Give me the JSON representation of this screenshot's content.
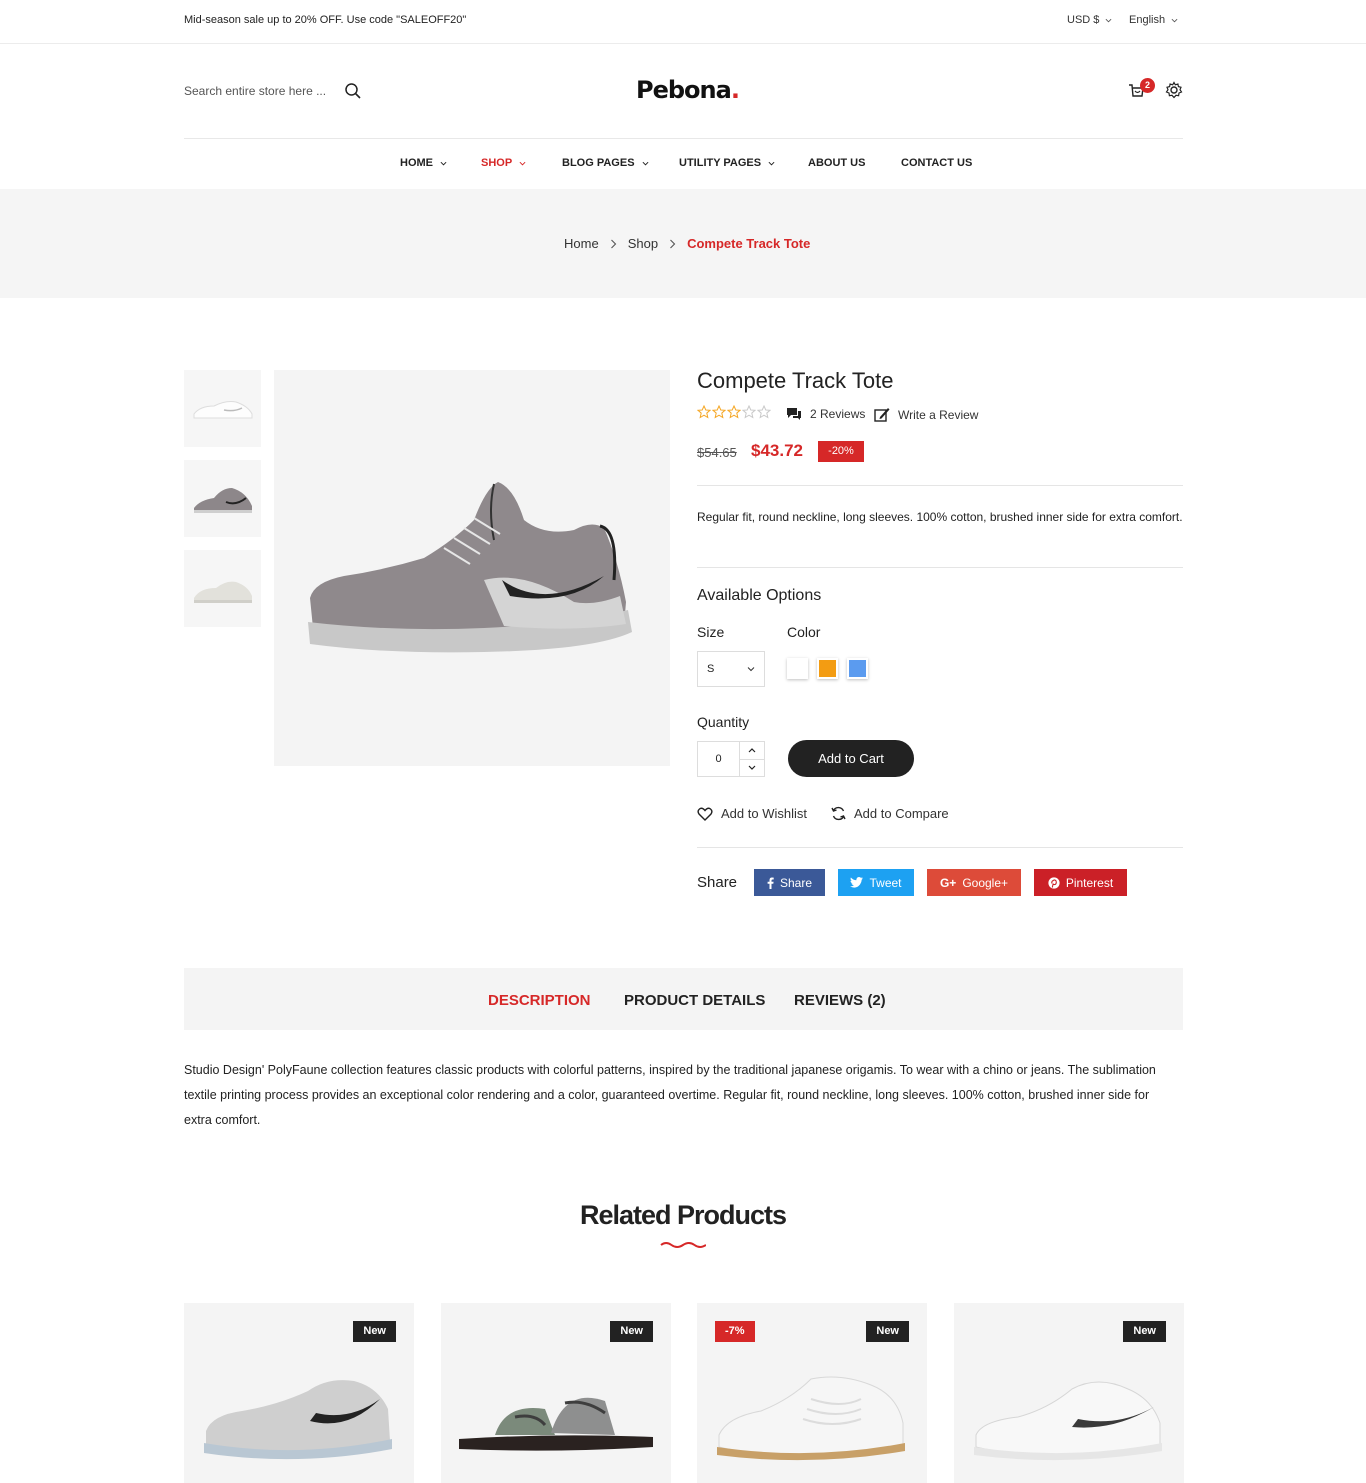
{
  "topbar": {
    "promo": "Mid-season sale up to 20% OFF. Use code \"SALEOFF20\"",
    "currency": "USD $",
    "language": "English"
  },
  "header": {
    "search_placeholder": "Search entire store here ...",
    "logo": "Pebona",
    "logo_dot": ".",
    "cart_count": "2"
  },
  "nav": {
    "items": [
      {
        "label": "HOME",
        "dropdown": true
      },
      {
        "label": "SHOP",
        "dropdown": true,
        "active": true
      },
      {
        "label": "BLOG PAGES",
        "dropdown": true
      },
      {
        "label": "UTILITY PAGES",
        "dropdown": true
      },
      {
        "label": "ABOUT US",
        "dropdown": false
      },
      {
        "label": "CONTACT US",
        "dropdown": false
      }
    ]
  },
  "breadcrumb": {
    "items": [
      "Home",
      "Shop"
    ],
    "current": "Compete Track Tote"
  },
  "product": {
    "title": "Compete Track Tote",
    "rating": 3,
    "rating_max": 5,
    "reviews_label": "2 Reviews",
    "write_review_label": "Write a Review",
    "old_price": "$54.65",
    "price": "$43.72",
    "discount": "-20%",
    "short_description": "Regular fit, round neckline, long sleeves. 100% cotton, brushed inner side for extra comfort.",
    "options_title": "Available Options",
    "size_label": "Size",
    "size_value": "S",
    "color_label": "Color",
    "colors": [
      "#ffffff",
      "#f39c12",
      "#5b9bef"
    ],
    "quantity_label": "Quantity",
    "quantity": "0",
    "add_to_cart": "Add to Cart",
    "wishlist_label": "Add to Wishlist",
    "compare_label": "Add to Compare",
    "share_label": "Share",
    "share_buttons": [
      {
        "label": "Share",
        "color": "#3b5998",
        "icon": "facebook-icon"
      },
      {
        "label": "Tweet",
        "color": "#1da1f2",
        "icon": "twitter-icon"
      },
      {
        "label": "Google+",
        "color": "#dd4b39",
        "icon": "google-plus-icon"
      },
      {
        "label": "Pinterest",
        "color": "#cb2027",
        "icon": "pinterest-icon"
      }
    ]
  },
  "tabs": {
    "items": [
      "DESCRIPTION",
      "PRODUCT DETAILS",
      "REVIEWS (2)"
    ],
    "active": 0,
    "description": "Studio Design' PolyFaune collection features classic products with colorful patterns, inspired by the traditional japanese origamis. To wear with a chino or jeans. The sublimation textile printing process provides an exceptional color rendering and a color, guaranteed overtime. Regular fit, round neckline, long sleeves. 100% cotton, brushed inner side for extra comfort."
  },
  "related": {
    "title": "Related Products",
    "products": [
      {
        "badges": [
          "New"
        ],
        "sale": ""
      },
      {
        "badges": [
          "New"
        ],
        "sale": ""
      },
      {
        "badges": [
          "New"
        ],
        "sale": "-7%"
      },
      {
        "badges": [
          "New"
        ],
        "sale": ""
      }
    ]
  },
  "colors": {
    "accent": "#d62828",
    "dark": "#222222",
    "band": "#f5f5f5"
  }
}
